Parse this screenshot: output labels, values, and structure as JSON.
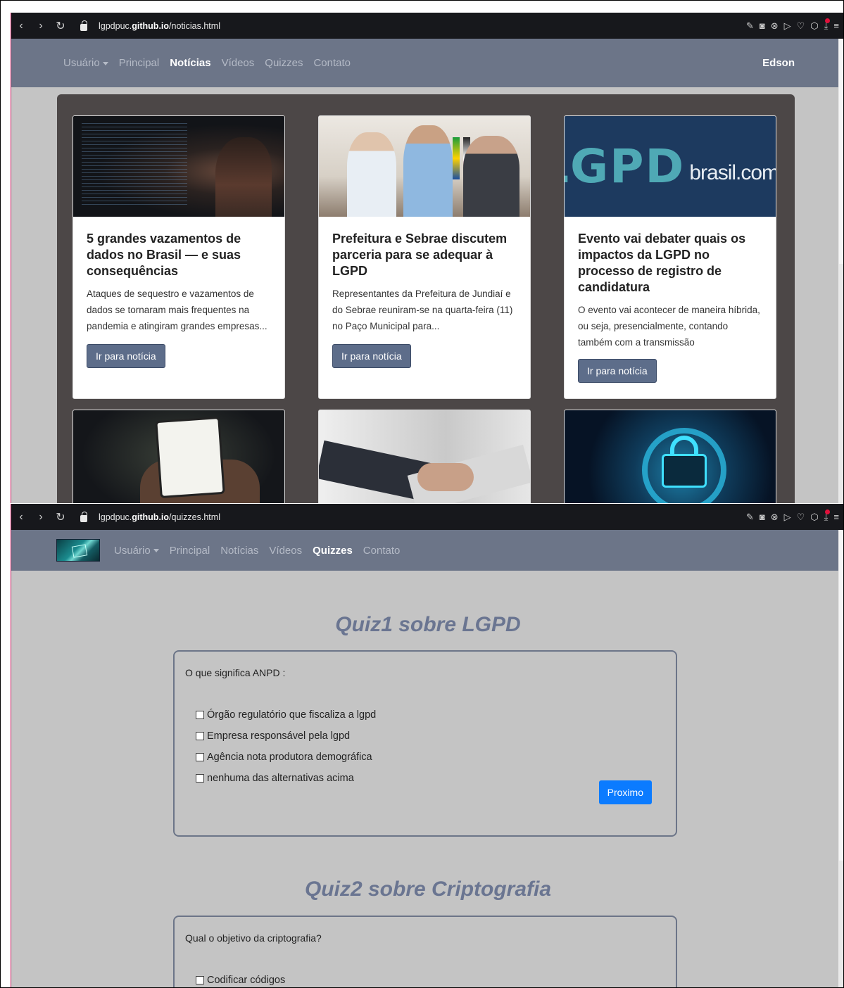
{
  "window1": {
    "url_prefix": "lgpdpuc.",
    "url_domain": "github.io",
    "url_path": "/noticias.html",
    "nav": {
      "user_menu": "Usuário",
      "items": [
        "Principal",
        "Notícias",
        "Vídeos",
        "Quizzes",
        "Contato"
      ],
      "active": "Notícias",
      "user_name": "Edson"
    },
    "cards": [
      {
        "title": "5 grandes vazamentos de dados no Brasil — e suas consequências",
        "text": "Ataques de sequestro e vazamentos de dados se tornaram mais frequentes na pandemia e atingiram grandes empresas...",
        "button": "Ir para notícia",
        "image_icon": "code-screen-image"
      },
      {
        "title": "Prefeitura e Sebrae discutem parceria para se adequar à LGPD",
        "text": "Representantes da Prefeitura de Jundiaí e do Sebrae reuniram-se na quarta-feira (11) no Paço Municipal para...",
        "button": "Ir para notícia",
        "image_icon": "meeting-image"
      },
      {
        "title": "Evento vai debater quais os impactos da LGPD no processo de registro de candidatura",
        "text": "O evento vai acontecer de maneira híbrida, ou seja, presencialmente, contando também com a transmissão",
        "button": "Ir para notícia",
        "image_icon": "lgpd-logo-image",
        "logo_main": "LGPD",
        "logo_sub": "brasil.com.br"
      }
    ]
  },
  "window2": {
    "url_prefix": "lgpdpuc.",
    "url_domain": "github.io",
    "url_path": "/quizzes.html",
    "nav": {
      "user_menu": "Usuário",
      "items": [
        "Principal",
        "Notícias",
        "Vídeos",
        "Quizzes",
        "Contato"
      ],
      "active": "Quizzes"
    },
    "quiz1": {
      "title": "Quiz1 sobre LGPD",
      "question": "O que significa ANPD :",
      "options": [
        "Órgão regulatório que fiscaliza a lgpd",
        "Empresa responsável pela lgpd",
        "Agência nota produtora demográfica",
        "nenhuma das alternativas acima"
      ],
      "next": "Proximo"
    },
    "quiz2": {
      "title": "Quiz2 sobre Criptografia",
      "question": "Qual o objetivo da criptografia?",
      "options": [
        "Codificar códigos"
      ]
    }
  },
  "colors": {
    "navbar": "#6c7588",
    "page_bg": "#c4c4c4",
    "panel": "#4c4747",
    "button": "#5d6d8a",
    "primary": "#0b7bff",
    "quiz_title": "#6a7591"
  }
}
